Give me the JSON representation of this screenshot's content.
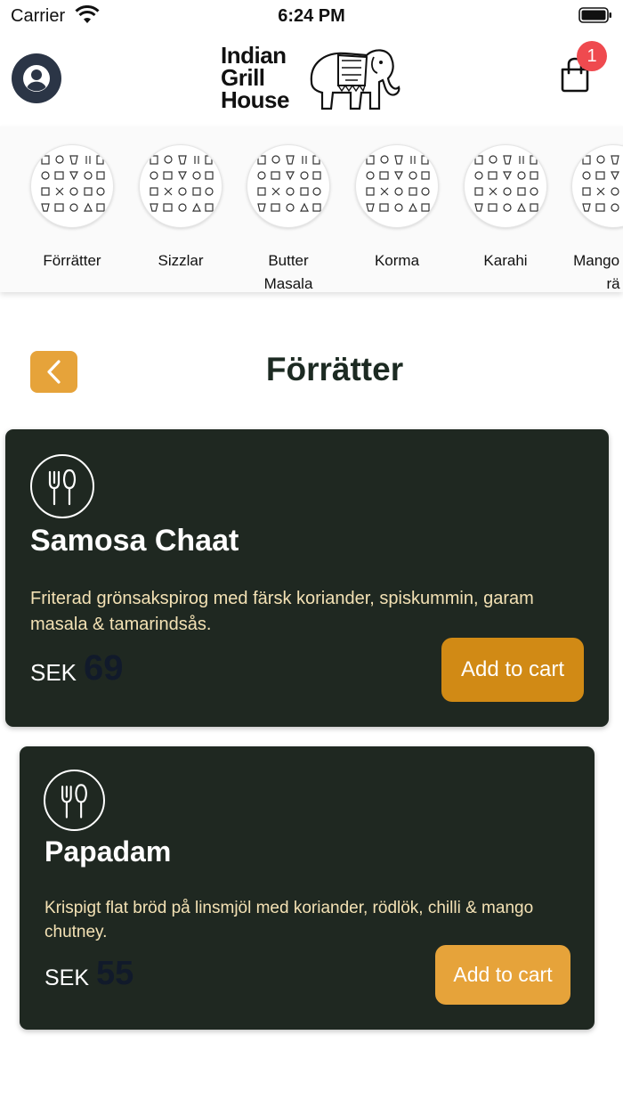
{
  "status_bar": {
    "carrier": "Carrier",
    "time": "6:24 PM"
  },
  "header": {
    "logo_lines": [
      "Indian",
      "Grill",
      "House"
    ],
    "cart_count": "1"
  },
  "categories": [
    {
      "label": "Förrätter"
    },
    {
      "label": "Sizzlar"
    },
    {
      "label": "Butter Masala"
    },
    {
      "label": "Korma"
    },
    {
      "label": "Karahi"
    },
    {
      "label": "Mango Balti rä"
    }
  ],
  "section": {
    "title": "Förrätter"
  },
  "items": [
    {
      "name": "Samosa Chaat",
      "description": "Friterad grönsakspirog med färsk koriander, spiskummin, garam masala & tamarindsås.",
      "currency": "SEK",
      "price": "69",
      "button_label": "Add to cart"
    },
    {
      "name": "Papadam",
      "description": "Krispigt flat bröd på linsmjöl med koriander, rödlök, chilli & mango chutney.",
      "currency": "SEK",
      "price": "55",
      "button_label": "Add to cart"
    }
  ],
  "colors": {
    "accent": "#e6a33a",
    "accent_pressed": "#d18a15",
    "card_bg": "#1f2821",
    "badge": "#ef4a4f"
  }
}
